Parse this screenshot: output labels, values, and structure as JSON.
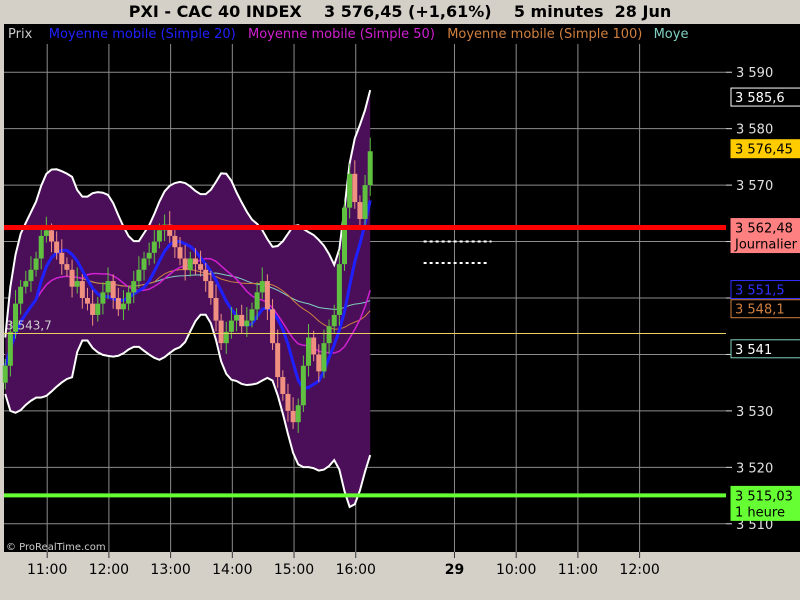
{
  "header": {
    "title": "PXI - CAC 40 INDEX    3 576,45 (+1,61%)    5 minutes  28 Jun"
  },
  "chart_data": {
    "type": "candlestick",
    "title": "PXI - CAC 40 INDEX    3 576,45 (+1,61%)    5 minutes  28 Jun",
    "legend": [
      "Prix",
      "Moyenne mobile (Simple 20)",
      "Moyenne mobile (Simple 50)",
      "Moyenne mobile (Simple 100)",
      "Moye"
    ],
    "ylim": [
      3505,
      3595
    ],
    "y_ticks": [
      3510,
      3520,
      3530,
      3540,
      3550,
      3560,
      3570,
      3580,
      3590
    ],
    "y_tick_labels": [
      "3 510",
      "3 520",
      "3 530",
      "",
      "",
      "",
      "3 570",
      "3 580",
      "3 590"
    ],
    "x_ticks": [
      {
        "label": "11:00",
        "t": 11.0
      },
      {
        "label": "12:00",
        "t": 12.0
      },
      {
        "label": "13:00",
        "t": 13.0
      },
      {
        "label": "14:00",
        "t": 14.0
      },
      {
        "label": "15:00",
        "t": 15.0
      },
      {
        "label": "16:00",
        "t": 16.0
      },
      {
        "label": "29",
        "t": 17.6
      },
      {
        "label": "10:00",
        "t": 18.6
      },
      {
        "label": "11:00",
        "t": 19.6
      },
      {
        "label": "12:00",
        "t": 20.6
      }
    ],
    "x_range": [
      10.3,
      22.0
    ],
    "price_tags": [
      {
        "value": 3585.6,
        "label": "3 585,6",
        "bg": "#000000",
        "fg": "#ffffff",
        "border": "#ffffff"
      },
      {
        "value": 3576.45,
        "label": "3 576,45",
        "bg": "#ffcc00",
        "fg": "#000000",
        "border": "#ffcc00"
      },
      {
        "value": 3562.48,
        "label": "3 562,48",
        "bg": "#ff8080",
        "fg": "#000000",
        "border": "#ff8080",
        "sub": "Journalier"
      },
      {
        "value": 3551.5,
        "label": "3 551,5",
        "bg": "#000000",
        "fg": "#3030ff",
        "border": "#3030ff"
      },
      {
        "value": 3548.1,
        "label": "3 548,1",
        "bg": "#000000",
        "fg": "#d08040",
        "border": "#d08040"
      },
      {
        "value": 3541.0,
        "label": "3 541",
        "bg": "#000000",
        "fg": "#ffffff",
        "border": "#80d0c0"
      },
      {
        "value": 3515.03,
        "label": "3 515,03",
        "bg": "#66ff33",
        "fg": "#000000",
        "border": "#66ff33",
        "sub": "1 heure"
      }
    ],
    "horizontal_lines": [
      {
        "value": 3562.48,
        "color": "#ff0000",
        "width": 5
      },
      {
        "value": 3515.03,
        "color": "#66ff33",
        "width": 4
      },
      {
        "value": 3543.7,
        "color": "#e8d060",
        "width": 1,
        "label": "3 543,7"
      }
    ],
    "dotted_levels": [
      {
        "value": 3560.0,
        "t0": 17.1,
        "t1": 18.2
      },
      {
        "value": 3556.2,
        "t0": 17.1,
        "t1": 18.15
      }
    ],
    "closes": [
      3538,
      3544,
      3549,
      3552,
      3553,
      3555,
      3557,
      3561,
      3562,
      3560,
      3558,
      3556,
      3555,
      3552,
      3553,
      3550,
      3549,
      3547,
      3549,
      3551,
      3553,
      3550,
      3548,
      3549,
      3551,
      3553,
      3555,
      3557,
      3558,
      3560,
      3562,
      3563,
      3561,
      3559,
      3557,
      3555,
      3557,
      3556,
      3555,
      3553,
      3550,
      3546,
      3542,
      3544,
      3546,
      3547,
      3545,
      3546,
      3548,
      3551,
      3553,
      3548,
      3542,
      3536,
      3533,
      3530,
      3528,
      3531,
      3538,
      3543,
      3540,
      3537,
      3542,
      3545,
      3547,
      3556,
      3566,
      3572,
      3567,
      3564,
      3570,
      3576
    ],
    "candle_t0": 10.32,
    "candle_step": 0.0833
  },
  "watermark": "© ProRealTime.com"
}
